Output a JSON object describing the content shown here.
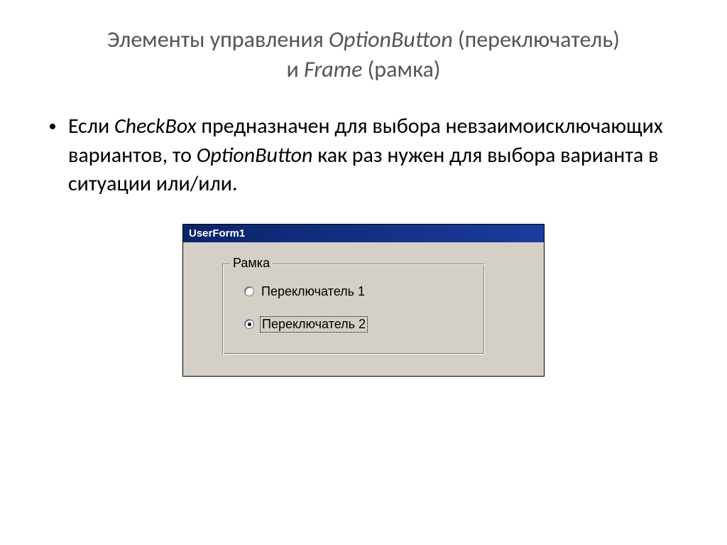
{
  "title": {
    "line1_prefix": "Элементы управления ",
    "line1_italic": "OptionButton",
    "line1_suffix": " (переключатель)",
    "line2_prefix": "и ",
    "line2_italic": "Frame",
    "line2_suffix": " (рамка)"
  },
  "body": {
    "p1_a": "Если ",
    "p1_b": "CheckBox",
    "p1_c": " предназначен для выбора невзаимоисключающих вариантов, то ",
    "p1_d": "OptionButton",
    "p1_e": " как раз нужен для выбора варианта в ситуации или/или."
  },
  "form": {
    "title": "UserForm1",
    "frame_label": "Рамка",
    "option1": {
      "label": "Переключатель 1",
      "checked": false
    },
    "option2": {
      "label": "Переключатель 2",
      "checked": true
    }
  }
}
